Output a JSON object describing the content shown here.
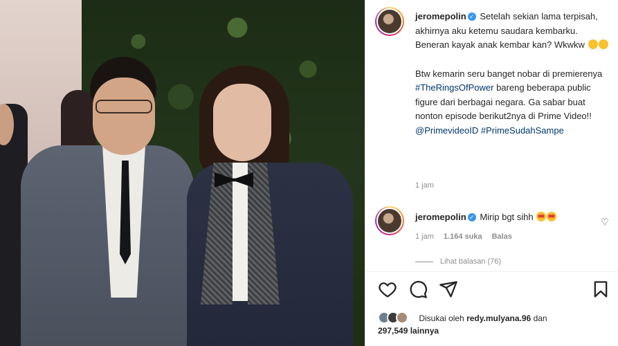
{
  "post": {
    "author": "jeromepolin",
    "caption_line1": "Setelah sekian lama terpisah, akhirnya aku ketemu saudara kembarku. Beneran kayak anak kembar kan? Wkwkw",
    "caption_p2_a": "Btw kemarin seru banget nobar di premierenya",
    "caption_hashtag1": "#TheRingsOfPower",
    "caption_p2_b": "bareng beberapa public figure dari berbagai negara. Ga sabar buat nonton episode berikut2nya di Prime Video!!",
    "caption_mention": "@PrimevideoID",
    "caption_hashtag2": "#PrimeSudahSampe",
    "time": "1 jam"
  },
  "comment": {
    "author": "jeromepolin",
    "text": "Mirip bgt sihh",
    "time": "1 jam",
    "likes": "1.164 suka",
    "reply_label": "Balas",
    "view_replies": "Lihat balasan (76)"
  },
  "liked_by": {
    "prefix": "Disukai oleh",
    "user": "redy.mulyana.96",
    "connector": "dan",
    "others": "297,549 lainnya"
  },
  "icons": {
    "like": "heart-icon",
    "comment": "comment-icon",
    "share": "share-icon",
    "save": "bookmark-icon",
    "verified": "verified-badge-icon"
  },
  "colors": {
    "link": "#00376b",
    "verified": "#3897f0",
    "meta": "#8e8e8e"
  }
}
